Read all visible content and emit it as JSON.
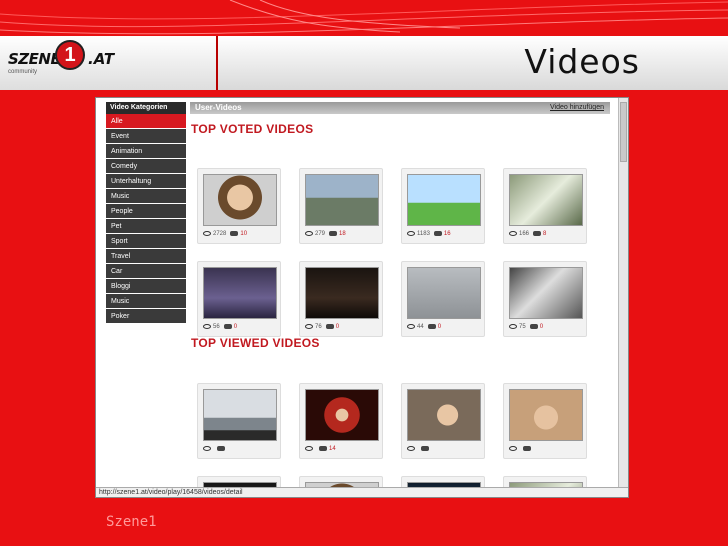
{
  "slide": {
    "title": "Videos",
    "footer": "Szene1"
  },
  "logo": {
    "left": "SZENE",
    "digit": "1",
    "right": ".AT",
    "tagline": "community"
  },
  "site": {
    "sidebar_heading": "Video Kategorien",
    "sidebar_items": [
      "Alle",
      "Event",
      "Animation",
      "Comedy",
      "Unterhaltung",
      "Music",
      "People",
      "Pet",
      "Sport",
      "Travel",
      "Car",
      "Bloggi",
      "Music",
      "Poker"
    ],
    "active_index": 0,
    "main_heading": "User-Videos",
    "main_link": "Video hinzufügen",
    "top_voted_title": "TOP VOTED VIDEOS",
    "top_viewed_title": "TOP VIEWED VIDEOS",
    "status_url": "http://szene1.at/video/play/16458/videos/detail"
  },
  "top_voted": [
    {
      "views": "2728",
      "comments": "10",
      "thumb": "portrait-woman"
    },
    {
      "views": "279",
      "comments": "18",
      "thumb": "street-scene"
    },
    {
      "views": "1183",
      "comments": "16",
      "thumb": "cartoon-castle"
    },
    {
      "views": "166",
      "comments": "8",
      "thumb": "crowd"
    },
    {
      "views": "56",
      "comments": "0",
      "thumb": "dark-room"
    },
    {
      "views": "76",
      "comments": "0",
      "thumb": "night-scene"
    },
    {
      "views": "44",
      "comments": "0",
      "thumb": "screen"
    },
    {
      "views": "75",
      "comments": "0",
      "thumb": "animals"
    }
  ],
  "top_viewed": [
    {
      "views": "",
      "comments": "",
      "thumb": "building"
    },
    {
      "views": "",
      "comments": "14",
      "thumb": "stage-woman"
    },
    {
      "views": "",
      "comments": "",
      "thumb": "girl-car"
    },
    {
      "views": "",
      "comments": "",
      "thumb": "girl-room"
    },
    {
      "views": "",
      "comments": "",
      "thumb": "dark-street"
    },
    {
      "views": "",
      "comments": "",
      "thumb": "portrait-woman"
    },
    {
      "views": "",
      "comments": "",
      "thumb": "night-lights"
    },
    {
      "views": "",
      "comments": "",
      "thumb": "crowd"
    }
  ],
  "colors": {
    "background": "#e81012",
    "accent": "#c11920",
    "sidebar": "#3a3a3a",
    "sidebar_active": "#d71920"
  }
}
